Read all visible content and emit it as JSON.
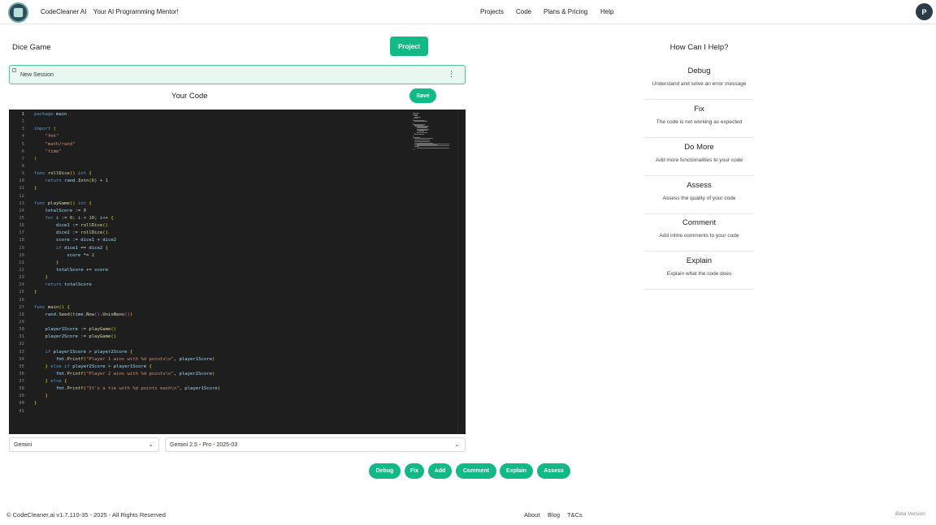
{
  "header": {
    "brand": "CodeCleaner AI",
    "tagline": "Your AI Programming Mentor!",
    "nav": [
      "Projects",
      "Code",
      "Plans & Pricing",
      "Help"
    ],
    "avatar_initial": "P"
  },
  "project": {
    "name": "Dice Game",
    "project_button": "Project",
    "session_label": "New Session",
    "code_heading": "Your Code",
    "save_button": "Save"
  },
  "editor": {
    "language": "go",
    "lines": [
      "package main",
      "",
      "import (",
      "    \"fmt\"",
      "    \"math/rand\"",
      "    \"time\"",
      ")",
      "",
      "func rollDice() int {",
      "    return rand.Intn(6) + 1",
      "}",
      "",
      "func playGame() int {",
      "    totalScore := 0",
      "    for i := 0; i < 10; i++ {",
      "        dice1 := rollDice()",
      "        dice2 := rollDice()",
      "        score := dice1 + dice2",
      "        if dice1 == dice2 {",
      "            score *= 2",
      "        }",
      "        totalScore += score",
      "    }",
      "    return totalScore",
      "}",
      "",
      "func main() {",
      "    rand.Seed(time.Now().UnixNano())",
      "",
      "    player1Score := playGame()",
      "    player2Score := playGame()",
      "",
      "    if player1Score > player2Score {",
      "        fmt.Printf(\"Player 1 wins with %d points\\n\", player1Score)",
      "    } else if player2Score > player1Score {",
      "        fmt.Printf(\"Player 2 wins with %d points\\n\", player2Score)",
      "    } else {",
      "        fmt.Printf(\"It's a tie with %d points each\\n\", player1Score)",
      "    }",
      "}",
      ""
    ]
  },
  "selects": {
    "provider": "Gemini",
    "model_name": "Gemini 2.5",
    "model_tier": "Pro",
    "model_version": "2025-03",
    "separator": "•"
  },
  "actions": [
    "Debug",
    "Fix",
    "Add",
    "Comment",
    "Explain",
    "Assess"
  ],
  "help": {
    "title": "How Can I Help?",
    "items": [
      {
        "title": "Debug",
        "desc": "Understand and solve an error message"
      },
      {
        "title": "Fix",
        "desc": "The code is not working as expected"
      },
      {
        "title": "Do More",
        "desc": "Add more functionalities to your code"
      },
      {
        "title": "Assess",
        "desc": "Assess the quality of your code"
      },
      {
        "title": "Comment",
        "desc": "Add inline comments to your code"
      },
      {
        "title": "Explain",
        "desc": "Explain what the code does"
      }
    ]
  },
  "footer": {
    "copyright": "© CodeCleaner.ai v1.7.110-35 - 2025 - All Rights Reserved",
    "links": [
      "About",
      "Blog",
      "T&Cs"
    ],
    "beta": "Beta Version"
  },
  "colors": {
    "accent": "#12b886",
    "editor_bg": "#1e1e1e",
    "session_bg": "#e8f8f1",
    "avatar_bg": "#2b3b48"
  },
  "icons": {
    "logo": "codecleaner-logo-icon",
    "session_menu": "vertical-ellipsis-icon",
    "dropdown": "chevron-down-icon"
  }
}
